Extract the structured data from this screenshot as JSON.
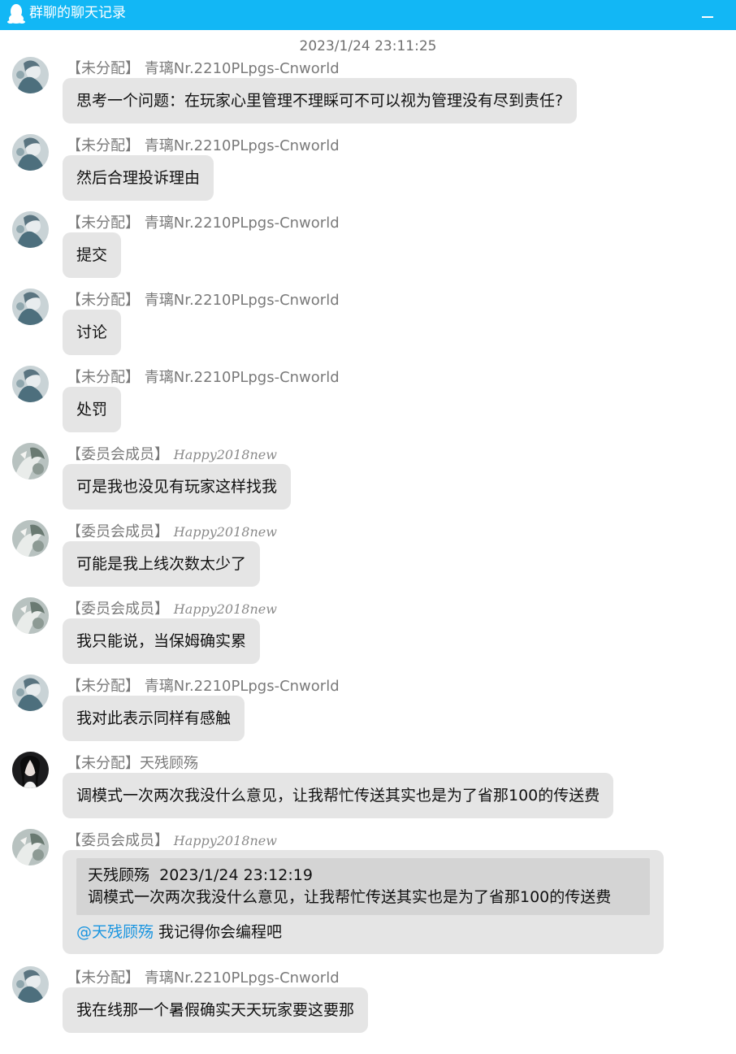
{
  "window": {
    "title": "群聊的聊天记录"
  },
  "timestamp": "2023/1/24 23:11:25",
  "messages": [
    {
      "role": "【未分配】",
      "name": "青璃Nr.2210PLpgs-Cnworld",
      "text": "思考一个问题：在玩家心里管理不理睬可不可以视为管理没有尽到责任?"
    },
    {
      "role": "【未分配】",
      "name": "青璃Nr.2210PLpgs-Cnworld",
      "text": "然后合理投诉理由"
    },
    {
      "role": "【未分配】",
      "name": "青璃Nr.2210PLpgs-Cnworld",
      "text": "提交"
    },
    {
      "role": "【未分配】",
      "name": "青璃Nr.2210PLpgs-Cnworld",
      "text": "讨论"
    },
    {
      "role": "【未分配】",
      "name": "青璃Nr.2210PLpgs-Cnworld",
      "text": "处罚"
    },
    {
      "role": "【委员会成员】",
      "name": "Happy2018new",
      "text": "可是我也没见有玩家这样找我"
    },
    {
      "role": "【委员会成员】",
      "name": "Happy2018new",
      "text": "可能是我上线次数太少了"
    },
    {
      "role": "【委员会成员】",
      "name": "Happy2018new",
      "text": "我只能说，当保姆确实累"
    },
    {
      "role": "【未分配】",
      "name": "青璃Nr.2210PLpgs-Cnworld",
      "text": "我对此表示同样有感触"
    },
    {
      "role": "【未分配】",
      "name": "天残顾殇",
      "text": "调模式一次两次我没什么意见，让我帮忙传送其实也是为了省那100的传送费"
    },
    {
      "role": "【委员会成员】",
      "name": "Happy2018new",
      "quote": {
        "author": "天残顾殇",
        "time": "2023/1/24 23:12:19",
        "text": "调模式一次两次我没什么意见，让我帮忙传送其实也是为了省那100的传送费"
      },
      "mention": "@天残顾殇",
      "text": " 我记得你会编程吧"
    },
    {
      "role": "【未分配】",
      "name": "青璃Nr.2210PLpgs-Cnworld",
      "text": "我在线那一个暑假确实天天玩家要这要那"
    }
  ],
  "colors": {
    "titlebar": "#12b7f5",
    "bubble": "#e5e5e5",
    "quote": "#d4d4d4",
    "mention": "#1a95e0"
  },
  "icons": {
    "app": "qq-penguin-icon",
    "minimize": "minimize-icon"
  }
}
